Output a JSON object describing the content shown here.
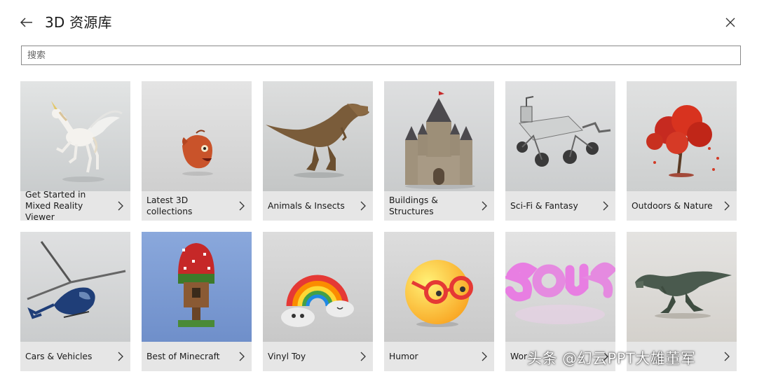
{
  "header": {
    "title": "3D 资源库",
    "back_icon": "back-arrow-icon",
    "close_icon": "close-icon"
  },
  "search": {
    "placeholder": "搜索",
    "value": ""
  },
  "categories": [
    {
      "label": "Get Started in Mixed Reality Viewer",
      "thumb": "unicorn"
    },
    {
      "label": "Latest 3D collections",
      "thumb": "anglerfish"
    },
    {
      "label": "Animals & Insects",
      "thumb": "t-rex"
    },
    {
      "label": "Buildings & Structures",
      "thumb": "castle"
    },
    {
      "label": "Sci-Fi & Fantasy",
      "thumb": "mars-rover"
    },
    {
      "label": "Outdoors & Nature",
      "thumb": "red-tree"
    },
    {
      "label": "Cars & Vehicles",
      "thumb": "helicopter"
    },
    {
      "label": "Best of Minecraft",
      "thumb": "minecraft-tree"
    },
    {
      "label": "Vinyl Toy",
      "thumb": "rainbow"
    },
    {
      "label": "Humor",
      "thumb": "emoji-glasses"
    },
    {
      "label": "Wor",
      "thumb": "squishy-word"
    },
    {
      "label": "",
      "thumb": "dinosaur-running"
    }
  ],
  "watermark": "头条 @幻云PPT大雄董军",
  "colors": {
    "tile_bg": "#d8d8d8",
    "label_bar": "#e6e6e6",
    "minecraft_bg": "#7f9fd6"
  }
}
